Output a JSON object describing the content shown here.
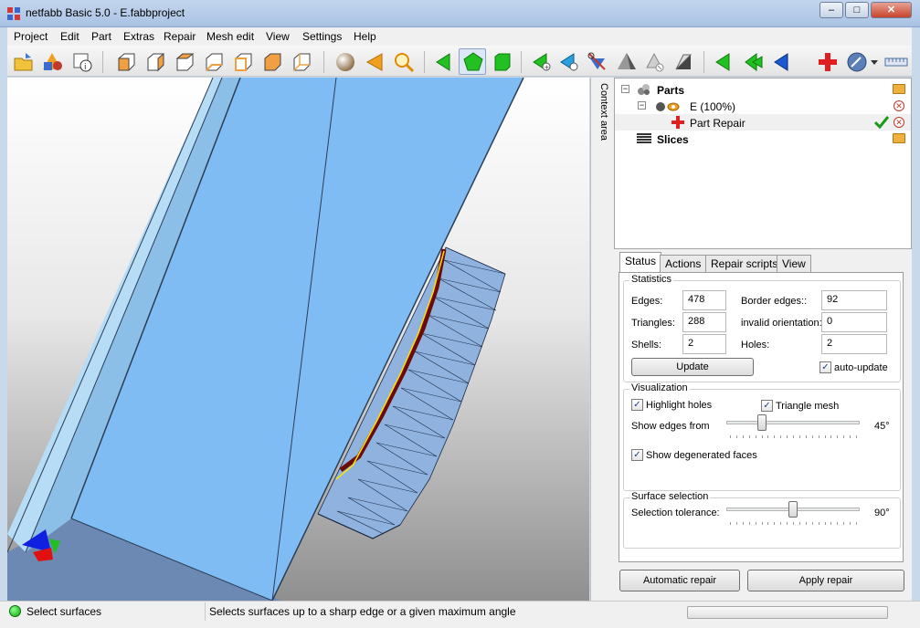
{
  "window": {
    "title": "netfabb Basic 5.0 - E.fabbproject",
    "minimize": "–",
    "maximize": "□",
    "close": "✕"
  },
  "menu": [
    "Project",
    "Edit",
    "Part",
    "Extras",
    "Repair",
    "Mesh edit",
    "View",
    "Settings",
    "Help"
  ],
  "context_area_label": "Context area",
  "tree": {
    "parts": "Parts",
    "part_e": "E (100%)",
    "part_repair": "Part Repair",
    "slices": "Slices"
  },
  "tabs": [
    "Status",
    "Actions",
    "Repair scripts",
    "View"
  ],
  "statistics": {
    "title": "Statistics",
    "edges_label": "Edges:",
    "edges": "478",
    "border_edges_label": "Border edges::",
    "border_edges": "92",
    "triangles_label": "Triangles:",
    "triangles": "288",
    "invalid_orientation_label": "invalid orientation:",
    "invalid_orientation": "0",
    "shells_label": "Shells:",
    "shells": "2",
    "holes_label": "Holes:",
    "holes": "2",
    "update_button": "Update",
    "auto_update_label": "auto-update",
    "auto_update_checked": true
  },
  "visualization": {
    "title": "Visualization",
    "highlight_holes_label": "Highlight holes",
    "highlight_holes_checked": true,
    "triangle_mesh_label": "Triangle mesh",
    "triangle_mesh_checked": true,
    "show_edges_label": "Show edges from",
    "show_edges_value": "45°",
    "show_edges_level": 0.25,
    "show_degenerated_label": "Show degenerated faces",
    "show_degenerated_checked": true
  },
  "surface_selection": {
    "title": "Surface selection",
    "tolerance_label": "Selection tolerance:",
    "tolerance_value": "90°",
    "tolerance_level": 0.5
  },
  "buttons": {
    "automatic_repair": "Automatic repair",
    "apply_repair": "Apply repair"
  },
  "statusbar": {
    "mode": "Select surfaces",
    "hint": "Selects surfaces up to a sharp edge or a given maximum angle"
  },
  "colors": {
    "model_blue": "#8ec3f5",
    "model_dark": "#3f6fa6",
    "accent_green": "#22c022",
    "repair_red": "#e02020"
  }
}
